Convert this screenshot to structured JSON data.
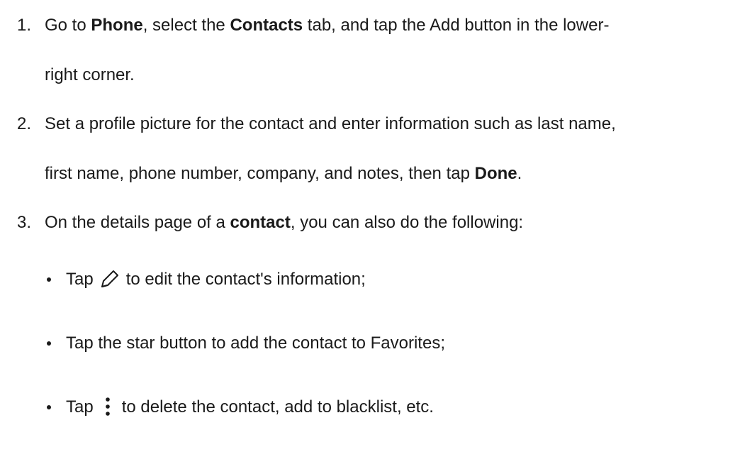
{
  "steps": [
    {
      "number": "1.",
      "line1": {
        "t1": "Go to ",
        "b1": "Phone",
        "t2": ", select the ",
        "b2": "Contacts",
        "t3": " tab, and tap the Add button in the lower-"
      },
      "line2": "right corner."
    },
    {
      "number": "2.",
      "line1": "Set a profile picture for the contact and enter information such as last name,",
      "line2": {
        "t1": "first name, phone number, company, and notes, then tap ",
        "b1": "Done",
        "t2": "."
      }
    },
    {
      "number": "3.",
      "line1": {
        "t1": "On the details page of a ",
        "b1": "contact",
        "t2": ", you can also do the following:"
      }
    }
  ],
  "bullets": [
    {
      "before": "Tap",
      "icon": "pencil-edit-icon",
      "after": "to edit the contact's information;"
    },
    {
      "text": "Tap the star button to add the contact to Favorites;"
    },
    {
      "before": "Tap",
      "icon": "more-vertical-dots-icon",
      "after": "to delete the contact, add to blacklist, etc."
    }
  ]
}
